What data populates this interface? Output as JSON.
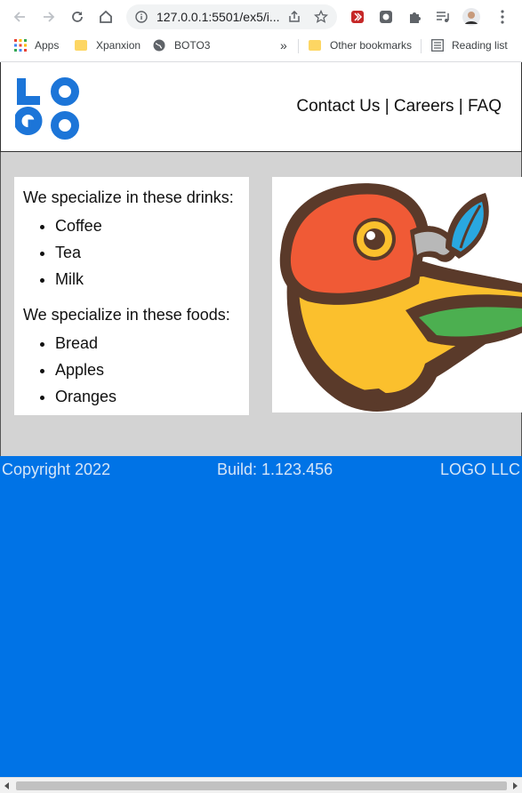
{
  "browser": {
    "url": "127.0.0.1:5501/ex5/i...",
    "bookmarks": {
      "apps": "Apps",
      "xpanxion": "Xpanxion",
      "boto3": "BOTO3",
      "overflow": "»",
      "other": "Other bookmarks",
      "reading": "Reading list"
    }
  },
  "header": {
    "logo_line1": "LO",
    "logo_line2": "GO",
    "nav": {
      "contact": "Contact Us",
      "sep1": "|",
      "careers": "Careers",
      "sep2": "|",
      "faq": "FAQ"
    }
  },
  "main": {
    "drinks_heading": "We specialize in these drinks:",
    "drinks": [
      "Coffee",
      "Tea",
      "Milk"
    ],
    "foods_heading": "We specialize in these foods:",
    "foods": [
      "Bread",
      "Apples",
      "Oranges"
    ]
  },
  "footer": {
    "copyright": "Copyright 2022",
    "build": "Build: 1.123.456",
    "company": "LOGO LLC"
  },
  "colors": {
    "brand_blue": "#0073e6",
    "main_bg": "#d3d3d3"
  }
}
